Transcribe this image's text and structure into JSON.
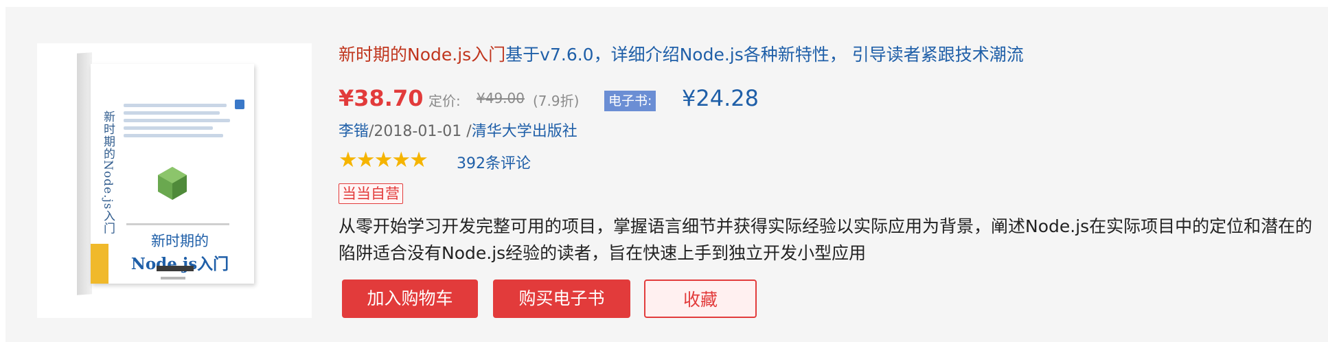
{
  "product": {
    "title_name": "新时期的Node.js入门",
    "title_subtitle": "基于v7.6.0，详细介绍Node.js各种新特性， 引导读者紧跟技术潮流",
    "cover": {
      "vertical_title": "新时期的Node.js入门",
      "title_cn": "新时期的",
      "title_en": "Node.js入门"
    },
    "price": {
      "current": "¥38.70",
      "list_label": "定价:",
      "list_price": "¥49.00",
      "discount": "(7.9折)",
      "ebook_label": "电子书:",
      "ebook_price": "¥24.28"
    },
    "meta": {
      "author": "李锴",
      "date": "/2018-01-01 /",
      "publisher": "清华大学出版社"
    },
    "rating": {
      "stars": 5,
      "stars_glyphs": "★★★★★",
      "reviews": "392条评论"
    },
    "badge": "当当自营",
    "description": "从零开始学习开发完整可用的项目，掌握语言细节并获得实际经验以实际应用为背景，阐述Node.js在实际项目中的定位和潜在的陷阱适合没有Node.js经验的读者，旨在快速上手到独立开发小型应用",
    "buttons": {
      "add_to_cart": "加入购物车",
      "buy_ebook": "购买电子书",
      "favorite": "收藏"
    }
  },
  "colors": {
    "accent_red": "#e23b3b",
    "link_blue": "#1f5fa8",
    "title_red": "#c0361e",
    "star": "#f5b400",
    "ebook_badge": "#6b8ed4",
    "card_bg": "#f5f5f5"
  }
}
